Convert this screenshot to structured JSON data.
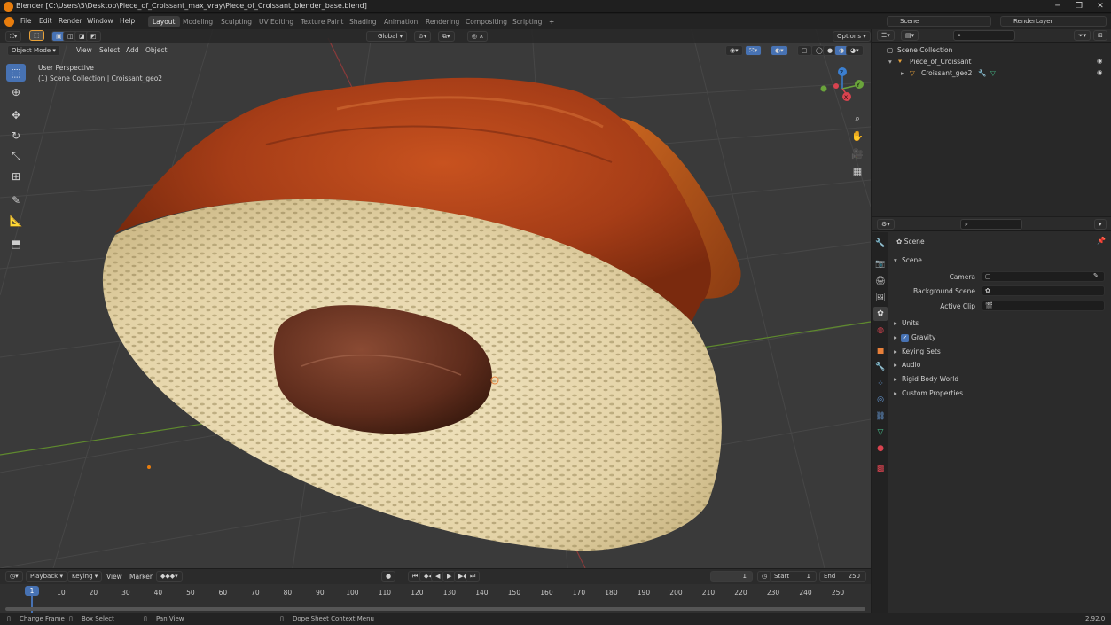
{
  "window": {
    "title": "Blender [C:\\Users\\5\\Desktop\\Piece_of_Croissant_max_vray\\Piece_of_Croissant_blender_base.blend]",
    "minimize": "─",
    "maximize": "❐",
    "close": "✕"
  },
  "menubar": {
    "items": [
      "File",
      "Edit",
      "Render",
      "Window",
      "Help"
    ],
    "workspaces": [
      "Layout",
      "Modeling",
      "Sculpting",
      "UV Editing",
      "Texture Paint",
      "Shading",
      "Animation",
      "Rendering",
      "Compositing",
      "Scripting"
    ],
    "add_tab": "+",
    "scene": "Scene",
    "render_layer": "RenderLayer"
  },
  "viewport": {
    "transform_orientation": "Global",
    "options": "Options",
    "mode": "Object Mode",
    "menus": [
      "View",
      "Select",
      "Add",
      "Object"
    ],
    "overlay_title": "User Perspective",
    "overlay_subtitle": "(1) Scene Collection | Croissant_geo2",
    "gizmo": {
      "y": "Y",
      "x": "X",
      "z": "Z"
    }
  },
  "outliner": {
    "root": "Scene Collection",
    "collection": "Piece_of_Croissant",
    "object": "Croissant_geo2"
  },
  "properties": {
    "breadcrumb": "Scene",
    "panel": "Scene",
    "camera_label": "Camera",
    "background_label": "Background Scene",
    "active_clip_label": "Active Clip",
    "gravity_checked": true,
    "sections": [
      "Units",
      "Gravity",
      "Keying Sets",
      "Audio",
      "Rigid Body World",
      "Custom Properties"
    ]
  },
  "timeline": {
    "menus": [
      "Playback",
      "Keying",
      "View",
      "Marker"
    ],
    "current_frame": "1",
    "start_label": "Start",
    "start": "1",
    "end_label": "End",
    "end": "250",
    "playhead": "1",
    "ticks": [
      "10",
      "20",
      "30",
      "40",
      "50",
      "60",
      "70",
      "80",
      "90",
      "100",
      "110",
      "120",
      "130",
      "140",
      "150",
      "160",
      "170",
      "180",
      "190",
      "200",
      "210",
      "220",
      "230",
      "240",
      "250"
    ]
  },
  "statusbar": {
    "items": [
      "Change Frame",
      "Box Select",
      "Pan View",
      "Dope Sheet Context Menu"
    ],
    "version": "2.92.0"
  },
  "colors": {
    "accent": "#4772b3",
    "header": "#232323",
    "viewport_bg": "#3a3a3a",
    "axis_x": "#d9434f",
    "axis_y": "#6aa43b",
    "axis_z": "#3b7fd1"
  }
}
